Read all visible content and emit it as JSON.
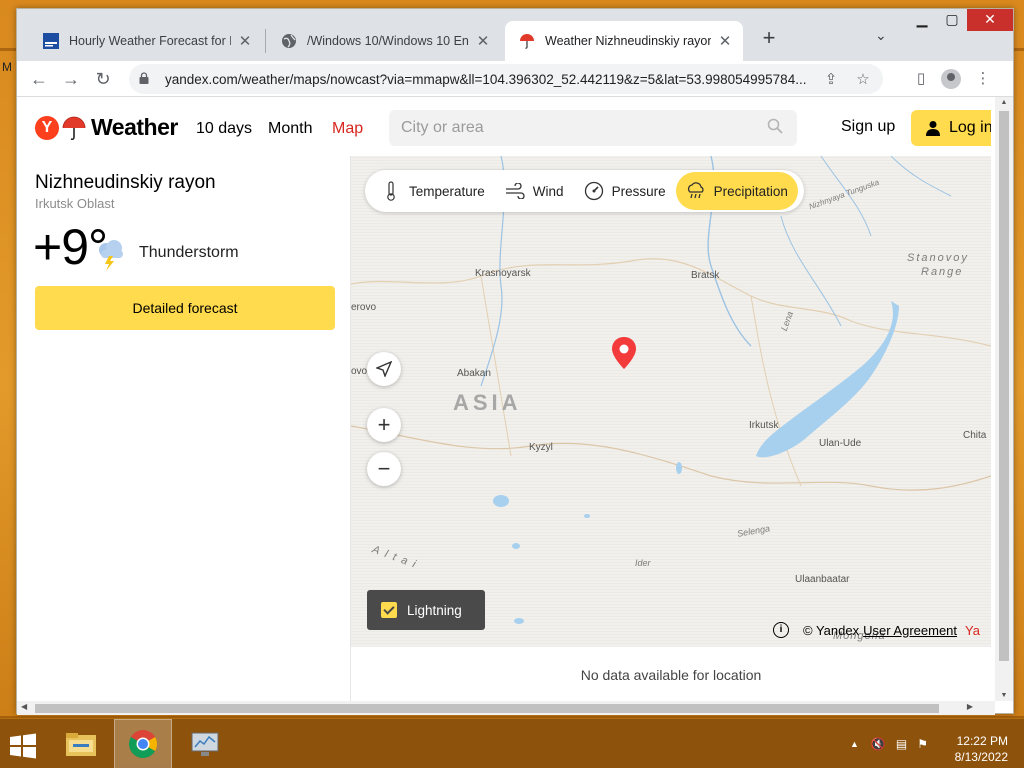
{
  "tabs": [
    {
      "title": "Hourly Weather Forecast for Rye",
      "favicon": "weather-channel-icon"
    },
    {
      "title": "/Windows 10/Windows 10 Enterp",
      "favicon": "globe-icon"
    },
    {
      "title": "Weather Nizhneudinskiy rayon —",
      "favicon": "yandex-weather-icon"
    }
  ],
  "browser": {
    "url": "yandex.com/weather/maps/nowcast?via=mmapw&ll=104.396302_52.442119&z=5&lat=53.998054995784..."
  },
  "header": {
    "logo_text": "Weather",
    "logo_letter": "Y",
    "nav": [
      "10 days",
      "Month",
      "Map"
    ],
    "search_placeholder": "City or area",
    "sign_up": "Sign up",
    "log_in": "Log in"
  },
  "location": {
    "name": "Nizhneudinskiy rayon",
    "region": "Irkutsk Oblast",
    "temperature": "+9°",
    "condition": "Thunderstorm",
    "detail_button": "Detailed forecast"
  },
  "map": {
    "layers": [
      "Temperature",
      "Wind",
      "Pressure",
      "Precipitation"
    ],
    "active_layer": "Precipitation",
    "lightning_label": "Lightning",
    "lightning_checked": true,
    "copyright": "© Yandex",
    "agreement": "User Agreement",
    "ya_mark": "Ya",
    "labels": {
      "krasnoyarsk": "Krasnoyarsk",
      "bratsk": "Bratsk",
      "abakan": "Abakan",
      "asia": "ASIA",
      "kyzyl": "Kyzyl",
      "irkutsk": "Irkutsk",
      "ulan_ude": "Ulan-Ude",
      "chita": "Chita",
      "ulaanbaatar": "Ulaanbaatar",
      "stanovoy": "Stanovoy",
      "range": "Range",
      "lena": "Lena",
      "selenga": "Selenga",
      "ider": "Ider",
      "altai": "Altai",
      "mongolia": "Mongolia",
      "nizhnyaya": "Nizhnyaya Tunguska",
      "kemerovo": "erovo",
      "kk": "ovo  k"
    },
    "no_data": "No data available for location"
  },
  "desktop": {
    "side_letter": "M"
  },
  "taskbar": {
    "time": "12:22 PM",
    "date": "8/13/2022"
  },
  "colors": {
    "accent_yellow": "#ffdb4d",
    "yandex_red": "#fc3f1d",
    "active_nav": "#d8261f",
    "window_close": "#c9302c"
  }
}
